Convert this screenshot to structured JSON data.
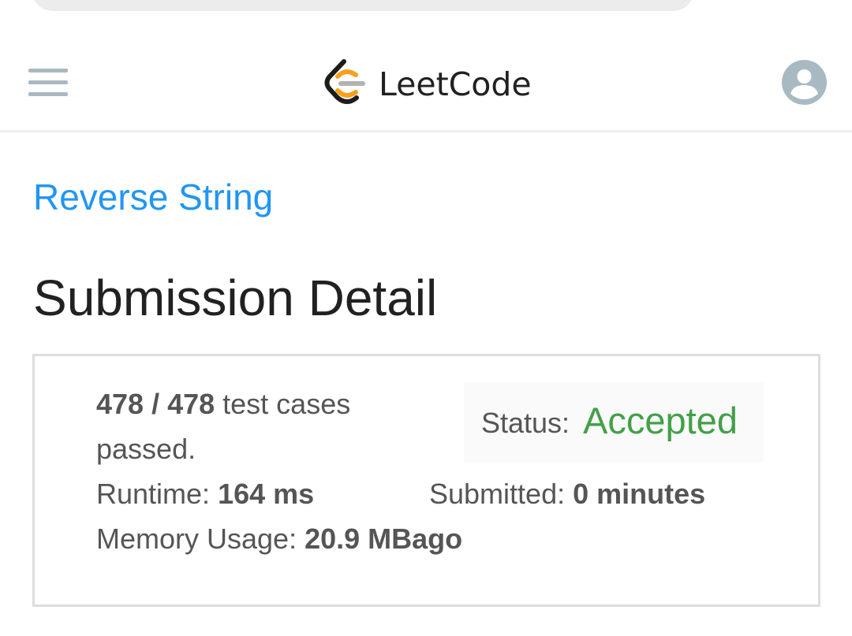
{
  "header": {
    "brand_name": "LeetCode",
    "menu_icon": "hamburger-menu-icon",
    "brand_icon": "leetcode-logo-icon",
    "account_icon": "user-avatar-icon",
    "colors": {
      "logo_dark": "#1c1c1c",
      "logo_orange": "#f89f1b",
      "logo_gray": "#b3b3b3",
      "nav_icon": "#a9b9c2"
    }
  },
  "problem": {
    "title": "Reverse String",
    "link_color": "#2196f3"
  },
  "page": {
    "title": "Submission Detail"
  },
  "submission": {
    "passed_count": "478 / 478",
    "passed_suffix_line1": "test cases",
    "passed_suffix_line2": "passed.",
    "status_label": "Status:",
    "status_value": "Accepted",
    "status_color": "#43a047",
    "runtime_label": "Runtime:",
    "runtime_value": "164 ms",
    "submitted_label": "Submitted:",
    "submitted_value": "0 minutes",
    "memory_label": "Memory Usage:",
    "memory_value": "20.9 MB",
    "submitted_suffix": "ago"
  }
}
